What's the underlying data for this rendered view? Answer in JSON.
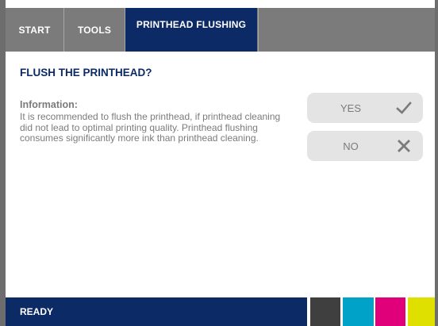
{
  "tabs": {
    "start": "START",
    "tools": "TOOLS",
    "active": "PRINTHEAD FLUSHING"
  },
  "dialog": {
    "title": "FLUSH THE PRINTHEAD?",
    "info_heading": "Information:",
    "info_text": "It is recommended to flush the printhead, if printhead cleaning did not lead to optimal printing quality. Printhead flushing consumes significantly more ink than printhead cleaning."
  },
  "buttons": {
    "yes_label": "YES",
    "yes_icon": "checkmark-icon",
    "no_label": "NO",
    "no_icon": "cross-icon"
  },
  "status": {
    "text": "READY"
  },
  "ink": {
    "colors": [
      "#3f3f3f",
      "#00a3c7",
      "#e0007a",
      "#e0e000"
    ],
    "names": [
      "black",
      "cyan",
      "magenta",
      "yellow"
    ]
  },
  "theme": {
    "primary": "#0c2a66",
    "tab_gray": "#7b7b7b",
    "button_gray": "#e4e4e4"
  }
}
